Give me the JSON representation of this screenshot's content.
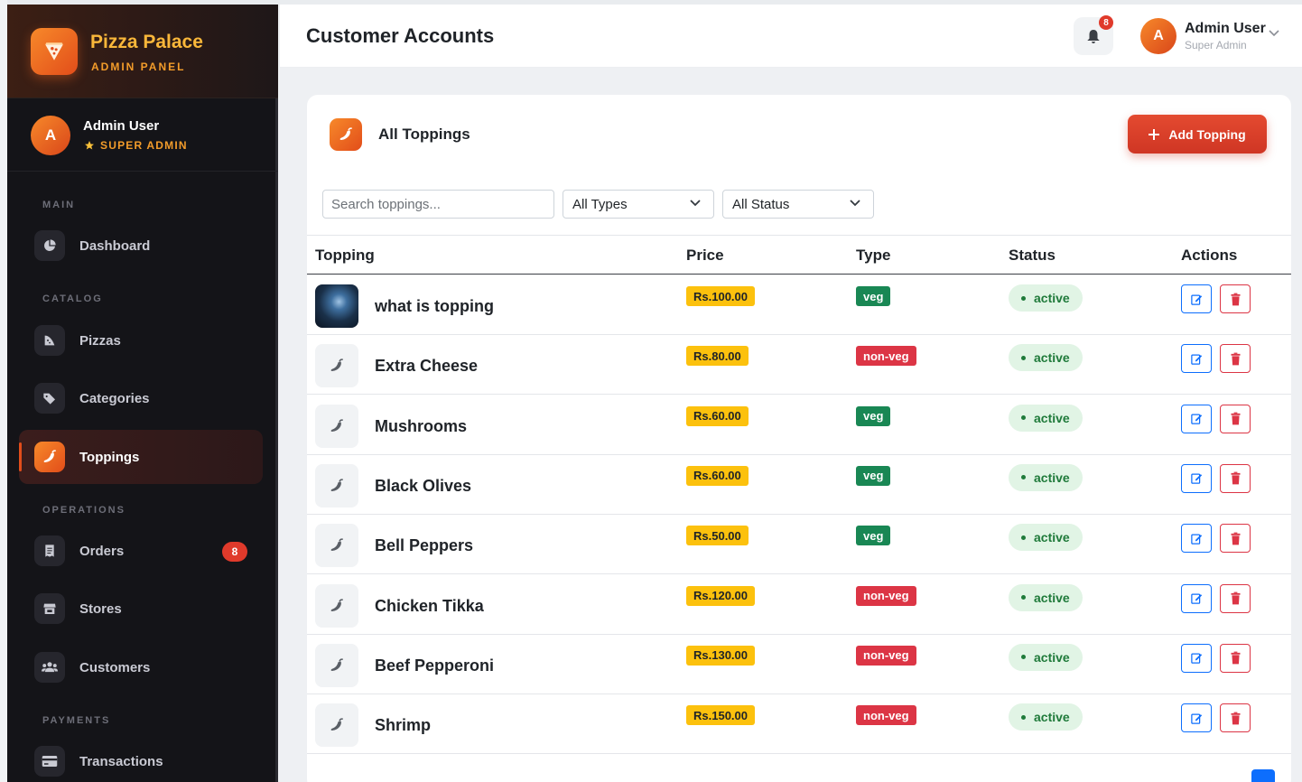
{
  "brand": {
    "name": "Pizza Palace",
    "subtitle": "ADMIN PANEL"
  },
  "sidebar_profile": {
    "initial": "A",
    "name": "Admin User",
    "role": "SUPER ADMIN"
  },
  "sidebar": {
    "sections": [
      {
        "title": "MAIN"
      },
      {
        "title": "CATALOG"
      },
      {
        "title": "OPERATIONS"
      },
      {
        "title": "PAYMENTS"
      }
    ],
    "items": [
      {
        "label": "Dashboard",
        "icon": "chart-pie-icon"
      },
      {
        "label": "Pizzas",
        "icon": "pizza-slice-icon"
      },
      {
        "label": "Categories",
        "icon": "tags-icon"
      },
      {
        "label": "Toppings",
        "icon": "pepper-icon",
        "active": true
      },
      {
        "label": "Orders",
        "icon": "receipt-icon",
        "badge": "8"
      },
      {
        "label": "Stores",
        "icon": "store-icon"
      },
      {
        "label": "Customers",
        "icon": "users-icon"
      },
      {
        "label": "Transactions",
        "icon": "credit-card-icon"
      }
    ]
  },
  "header": {
    "title": "Customer Accounts",
    "notification_count": "8",
    "user": {
      "initial": "A",
      "name": "Admin User",
      "role": "Super Admin"
    }
  },
  "card": {
    "title": "All Toppings",
    "add_button": "Add Topping",
    "search_placeholder": "Search toppings...",
    "type_filter": "All Types",
    "status_filter": "All Status"
  },
  "table": {
    "columns": [
      "Topping",
      "Price",
      "Type",
      "Status",
      "Actions"
    ],
    "rows": [
      {
        "name": "what is topping",
        "price": "Rs.100.00",
        "type": "veg",
        "status": "active",
        "image": true
      },
      {
        "name": "Extra Cheese",
        "price": "Rs.80.00",
        "type": "non-veg",
        "status": "active"
      },
      {
        "name": "Mushrooms",
        "price": "Rs.60.00",
        "type": "veg",
        "status": "active"
      },
      {
        "name": "Black Olives",
        "price": "Rs.60.00",
        "type": "veg",
        "status": "active"
      },
      {
        "name": "Bell Peppers",
        "price": "Rs.50.00",
        "type": "veg",
        "status": "active"
      },
      {
        "name": "Chicken Tikka",
        "price": "Rs.120.00",
        "type": "non-veg",
        "status": "active"
      },
      {
        "name": "Beef Pepperoni",
        "price": "Rs.130.00",
        "type": "non-veg",
        "status": "active"
      },
      {
        "name": "Shrimp",
        "price": "Rs.150.00",
        "type": "non-veg",
        "status": "active"
      }
    ]
  },
  "colors": {
    "accent_orange": "#f7892a",
    "accent_red": "#e24d1a",
    "sidebar_bg": "#141418",
    "price_badge": "#fcc10d",
    "veg": "#198754",
    "non_veg": "#dc3545",
    "status_active_bg": "#e1f4e5"
  }
}
